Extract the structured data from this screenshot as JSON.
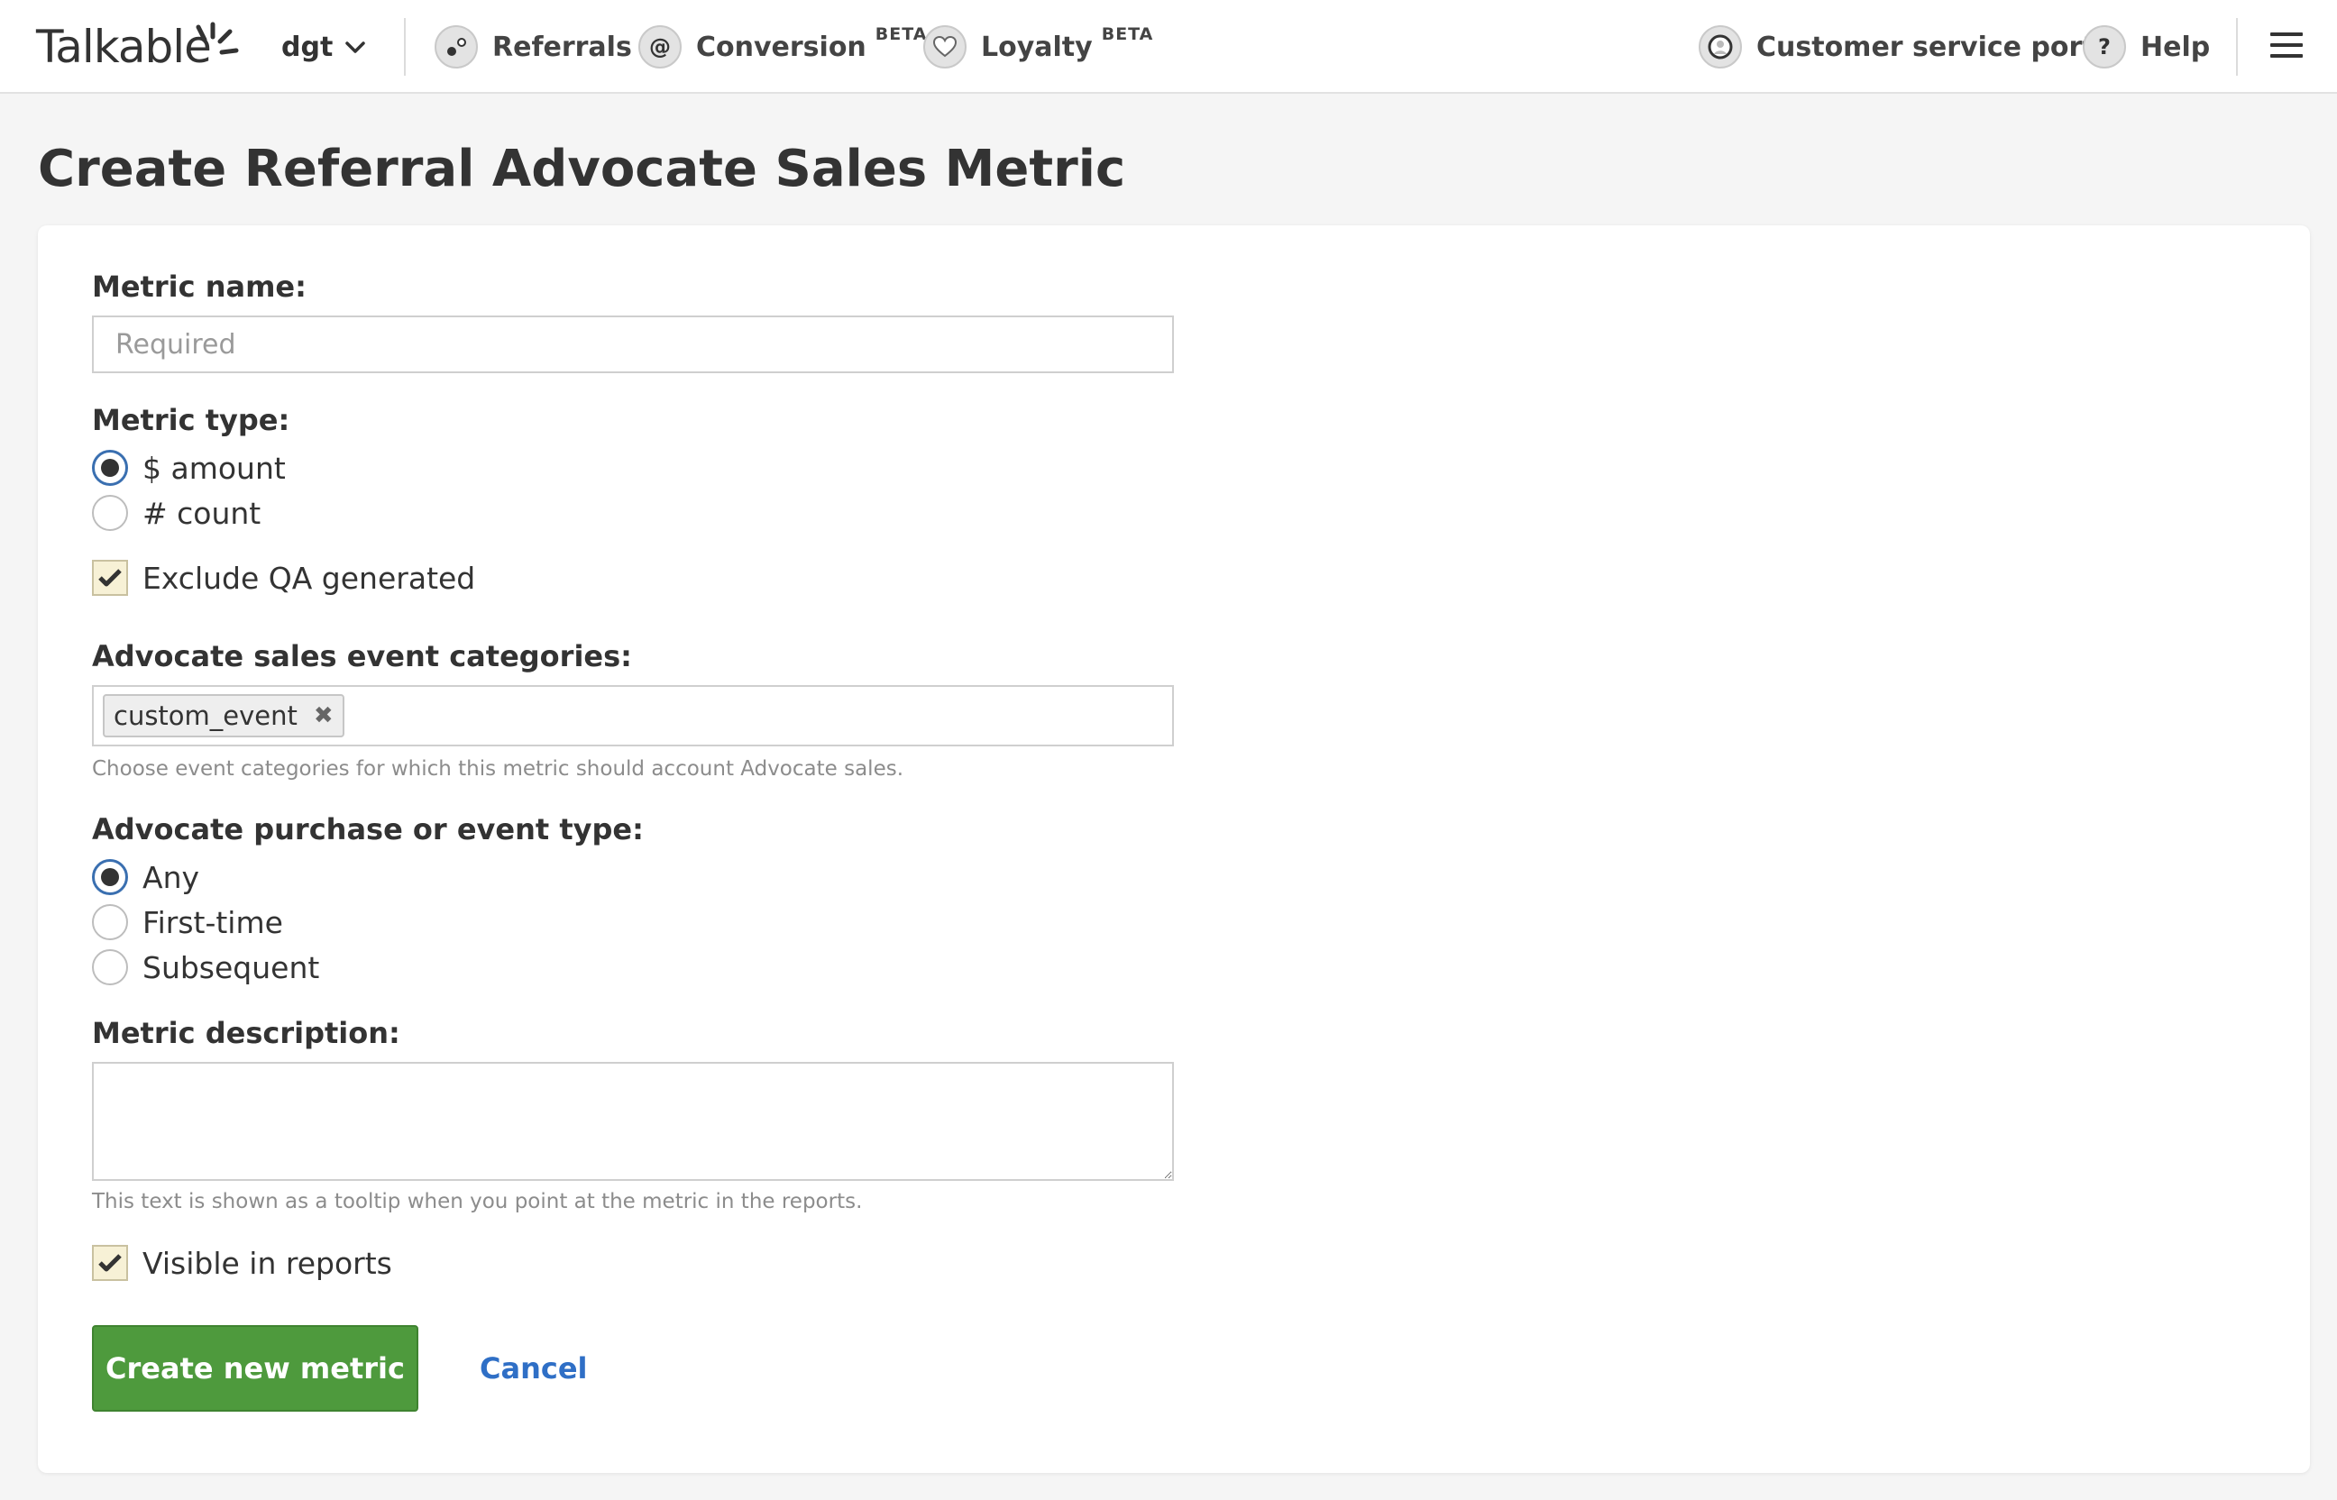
{
  "header": {
    "logo_text": "Talkable",
    "site_selector": {
      "value": "dgt"
    },
    "nav": [
      {
        "label": "Referrals",
        "icon": "referrals-icon",
        "beta": ""
      },
      {
        "label": "Conversion",
        "icon": "at-sign-icon",
        "icon_glyph": "@",
        "beta": "BETA"
      },
      {
        "label": "Loyalty",
        "icon": "heart-icon",
        "beta": "BETA"
      }
    ],
    "right": [
      {
        "label": "Customer service portal",
        "icon": "customer-service-icon"
      },
      {
        "label": "Help",
        "icon": "help-icon",
        "icon_glyph": "?"
      }
    ]
  },
  "page": {
    "title": "Create Referral Advocate Sales Metric"
  },
  "form": {
    "metric_name": {
      "label": "Metric name:",
      "value": "",
      "placeholder": "Required"
    },
    "metric_type": {
      "label": "Metric type:",
      "options": [
        {
          "label": "$ amount",
          "checked": true
        },
        {
          "label": "# count",
          "checked": false
        }
      ]
    },
    "exclude_qa": {
      "label": "Exclude QA generated",
      "checked": true
    },
    "event_categories": {
      "label": "Advocate sales event categories:",
      "tags": [
        "custom_event"
      ],
      "help": "Choose event categories for which this metric should account Advocate sales."
    },
    "purchase_type": {
      "label": "Advocate purchase or event type:",
      "options": [
        {
          "label": "Any",
          "checked": true
        },
        {
          "label": "First-time",
          "checked": false
        },
        {
          "label": "Subsequent",
          "checked": false
        }
      ]
    },
    "description": {
      "label": "Metric description:",
      "value": "",
      "help": "This text is shown as a tooltip when you point at the metric in the reports."
    },
    "visible_in_reports": {
      "label": "Visible in reports",
      "checked": true
    },
    "submit_label": "Create new metric",
    "cancel_label": "Cancel"
  },
  "colors": {
    "primary_button": "#4e9a3d",
    "link": "#2f6fc6",
    "radio_ring": "#3a6fb0",
    "checkbox_fill": "#f7f1d6"
  }
}
